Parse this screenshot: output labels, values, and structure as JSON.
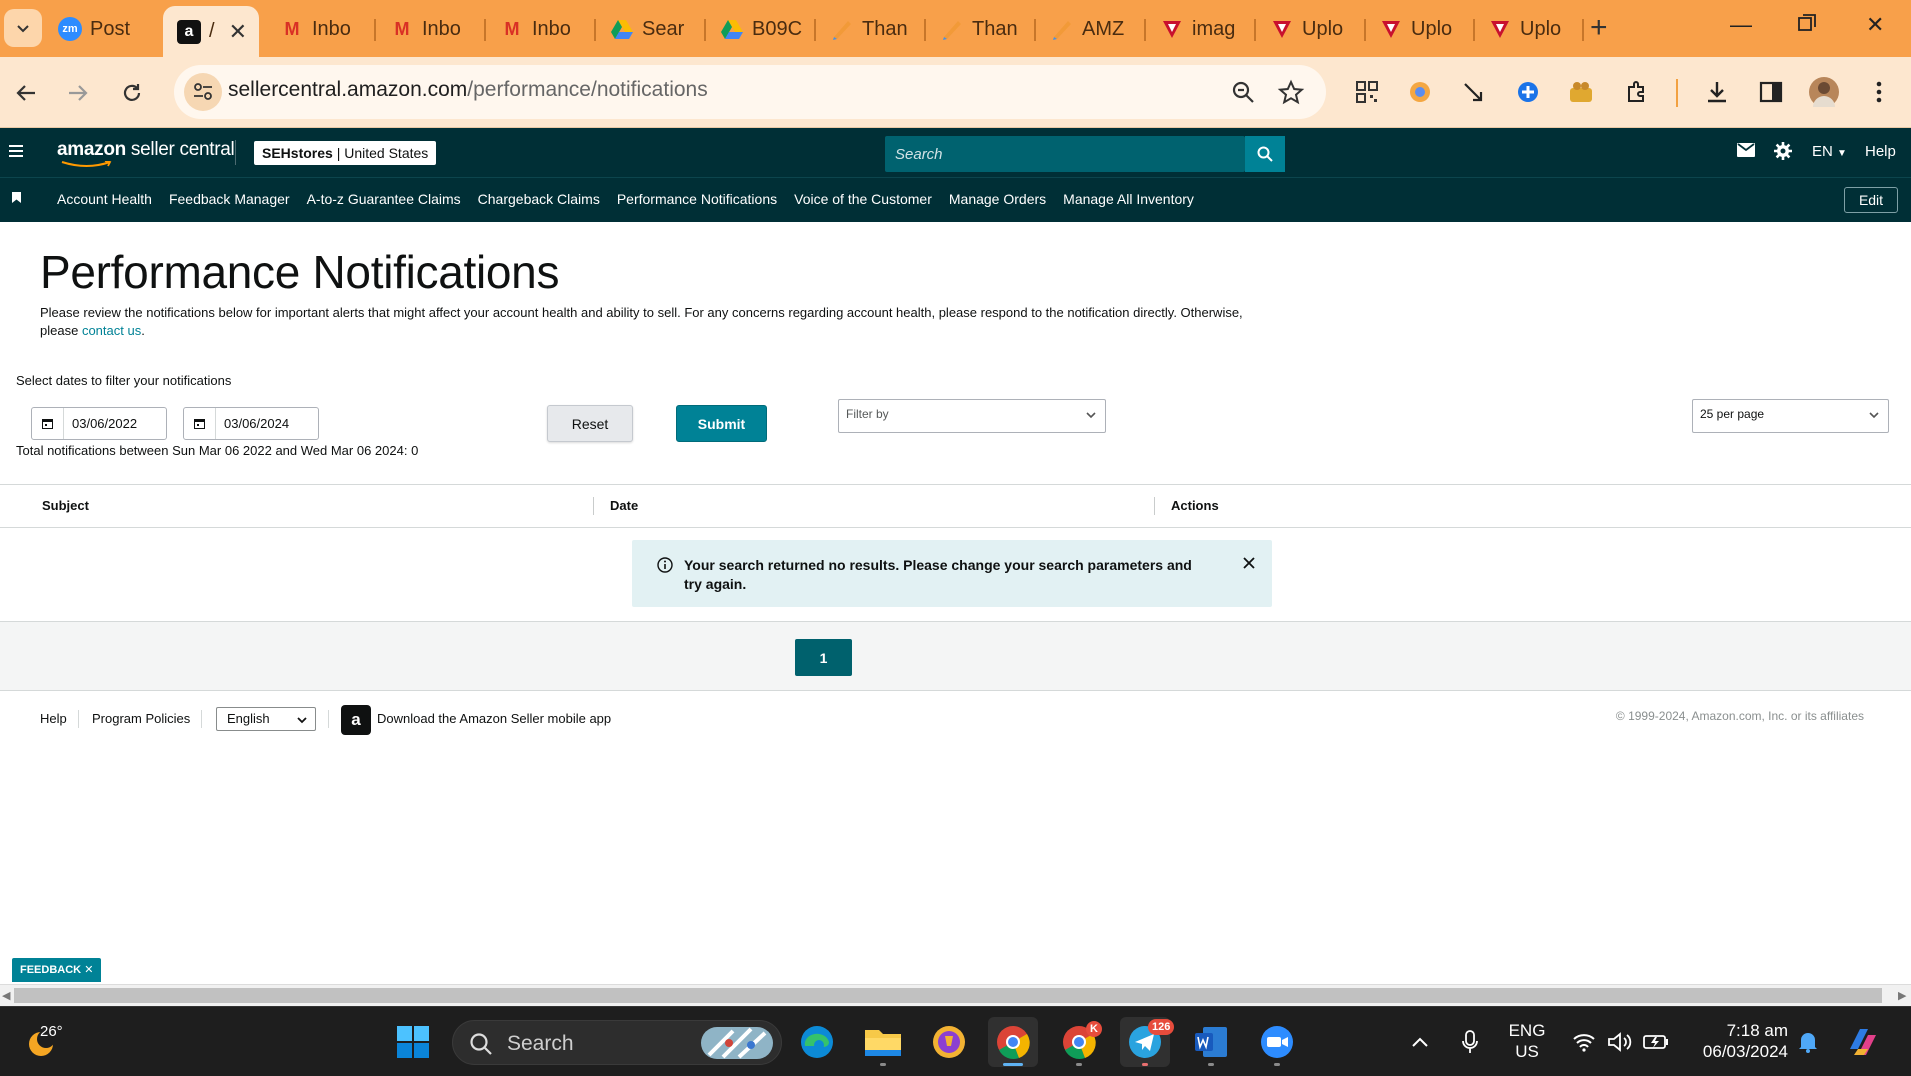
{
  "browser": {
    "tabs": [
      {
        "label": "Post",
        "icon": "zoom-icon"
      },
      {
        "label": "",
        "icon": "amazon-icon",
        "active": true
      },
      {
        "label": "Inbo",
        "icon": "gmail-icon"
      },
      {
        "label": "Inbo",
        "icon": "gmail-icon"
      },
      {
        "label": "Inbo",
        "icon": "gmail-icon"
      },
      {
        "label": "Sear",
        "icon": "google-drive-icon"
      },
      {
        "label": "B09C",
        "icon": "google-drive-icon"
      },
      {
        "label": "Than",
        "icon": "pen-icon"
      },
      {
        "label": "Than",
        "icon": "pen-icon"
      },
      {
        "label": "AMZ",
        "icon": "pen-icon"
      },
      {
        "label": "imag",
        "icon": "shield-logo-icon"
      },
      {
        "label": "Uplo",
        "icon": "shield-logo-icon"
      },
      {
        "label": "Uplo",
        "icon": "shield-logo-icon"
      },
      {
        "label": "Uplo",
        "icon": "shield-logo-icon"
      }
    ],
    "url_domain": "sellercentral.amazon.com",
    "url_path": "/performance/notifications",
    "colors": {
      "tabstrip": "#f8a04a",
      "toolbar": "#fde7cf"
    }
  },
  "header": {
    "logo_bold": "amazon",
    "logo_rest": " seller central",
    "store_name": "SEHstores",
    "store_region": "United States",
    "search_placeholder": "Search",
    "language": "EN",
    "help": "Help",
    "colors": {
      "header_bg": "#002f36",
      "search_bg": "#00626f",
      "accent": "#008296"
    }
  },
  "nav": {
    "items": [
      "Account Health",
      "Feedback Manager",
      "A-to-z Guarantee Claims",
      "Chargeback Claims",
      "Performance Notifications",
      "Voice of the Customer",
      "Manage Orders",
      "Manage All Inventory"
    ],
    "edit_label": "Edit"
  },
  "main": {
    "title": "Performance Notifications",
    "description": "Please review the notifications below for important alerts that might affect your account health and ability to sell. For any concerns regarding account health, please respond to the notification directly. Otherwise, please",
    "contact_link": "contact us",
    "filter_label": "Select dates to filter your notifications",
    "date_from": "03/06/2022",
    "date_to": "03/06/2024",
    "reset_label": "Reset",
    "submit_label": "Submit",
    "filter_by_placeholder": "Filter by",
    "per_page": "25 per page",
    "total_text": "Total notifications between Sun Mar 06 2022 and Wed Mar 06 2024: 0",
    "columns": [
      "Subject",
      "Date",
      "Actions"
    ],
    "alert_message": "Your search returned no results. Please change your search parameters and try again.",
    "current_page": "1"
  },
  "footer": {
    "help": "Help",
    "program_policies": "Program Policies",
    "language": "English",
    "app_download": "Download the Amazon Seller mobile app",
    "copyright": "© 1999-2024, Amazon.com, Inc. or its affiliates"
  },
  "feedback_label": "FEEDBACK",
  "taskbar": {
    "weather_temp": "26°",
    "search_label": "Search",
    "telegram_badge": "126",
    "chrome_profile_badge": "K",
    "language_line1": "ENG",
    "language_line2": "US",
    "time": "7:18 am",
    "date": "06/03/2024"
  }
}
